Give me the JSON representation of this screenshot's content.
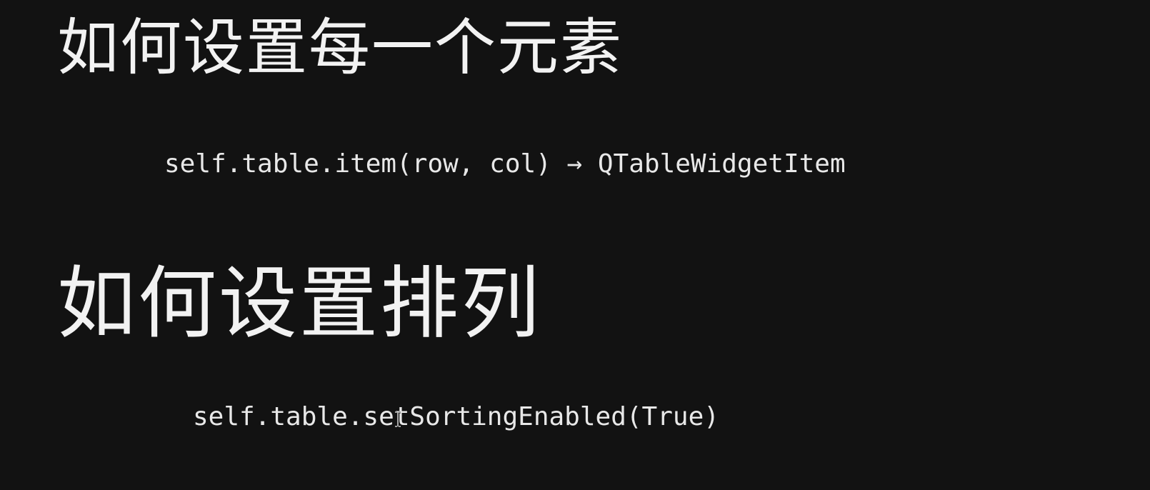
{
  "slide": {
    "section_1": {
      "heading": "如何设置每一个元素",
      "code": "self.table.item(row, col) → QTableWidgetItem"
    },
    "section_2": {
      "heading": "如何设置排列",
      "code": "self.table.setSortingEnabled(True)"
    }
  },
  "colors": {
    "background": "#121212",
    "text": "#f2f2f2"
  },
  "icons": {
    "cursor": "text-cursor-icon"
  }
}
